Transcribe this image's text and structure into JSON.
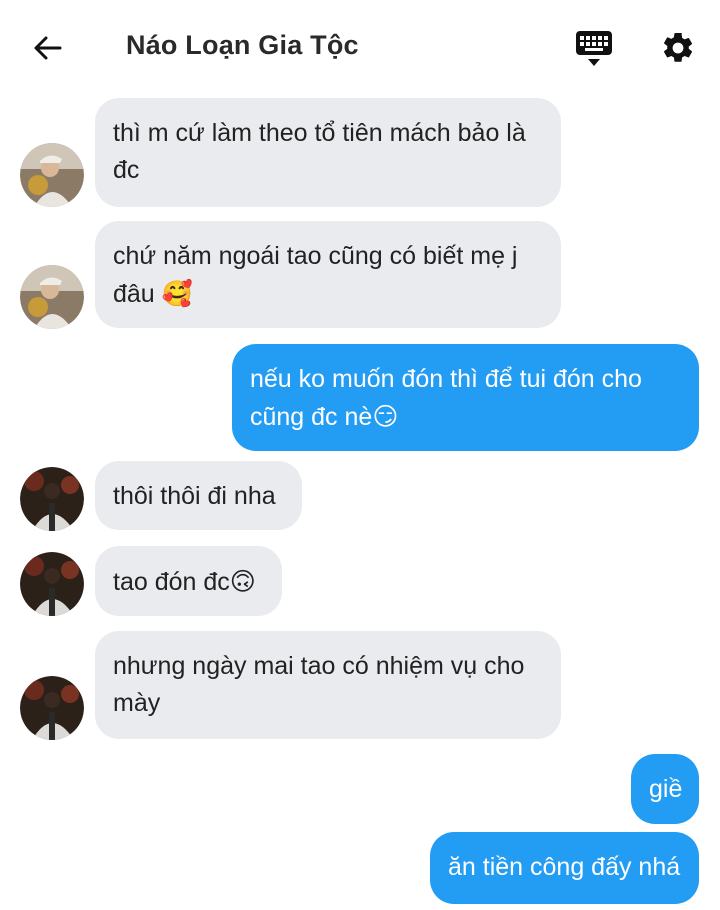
{
  "header": {
    "title": "Náo Loạn Gia Tộc",
    "back_icon": "arrow-left-icon",
    "keyboard_icon": "keyboard-icon",
    "settings_icon": "gear-icon"
  },
  "colors": {
    "incoming_bubble": "#e9ebef",
    "outgoing_bubble": "#239cf3",
    "outgoing_text": "#ffffff"
  },
  "messages": [
    {
      "direction": "in",
      "text": "thì m cứ làm theo tổ tiên mách bảo là đc"
    },
    {
      "direction": "in",
      "text": "chứ năm ngoái tao cũng có biết mẹ j đâu",
      "emoji": "🥰"
    },
    {
      "direction": "out",
      "text": "nếu ko muốn đón thì để tui đón cho cũng đc nè",
      "emoji": "😏"
    },
    {
      "direction": "in",
      "text": "thôi thôi đi nha"
    },
    {
      "direction": "in",
      "text": "tao đón đc",
      "emoji": "🙃"
    },
    {
      "direction": "in",
      "text": "nhưng ngày mai tao có nhiệm vụ cho mày"
    },
    {
      "direction": "out",
      "text": "giề"
    },
    {
      "direction": "out",
      "text": "ăn tiền công đấy nhá"
    }
  ]
}
